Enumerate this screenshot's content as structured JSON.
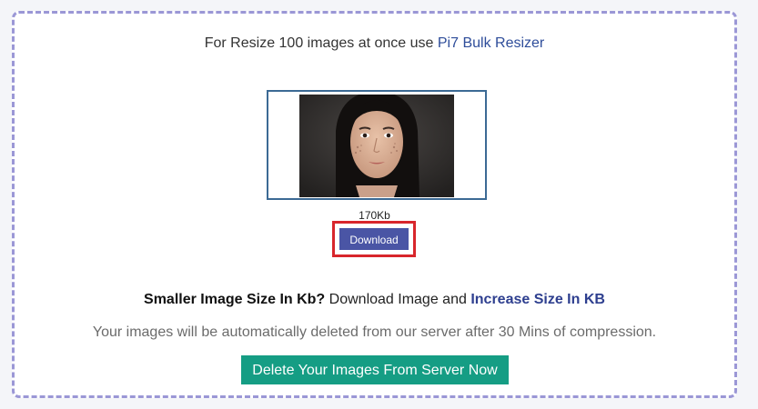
{
  "promo": {
    "text": "For Resize 100 images at once use",
    "link_label": "Pi7 Bulk Resizer"
  },
  "preview": {
    "file_size": "170Kb"
  },
  "download": {
    "label": "Download"
  },
  "increase": {
    "question": "Smaller Image Size In Kb?",
    "middle_text": "Download Image and",
    "link_label": "Increase Size In KB"
  },
  "notice": {
    "text": "Your images will be automatically deleted from our server after 30 Mins of compression."
  },
  "delete": {
    "label": "Delete Your Images From Server Now"
  },
  "colors": {
    "download_bg": "#4a55a5",
    "highlight_border": "#d8262c",
    "delete_bg": "#159d84",
    "link": "#2e4d9a",
    "dashed_border": "#9b97d6"
  }
}
